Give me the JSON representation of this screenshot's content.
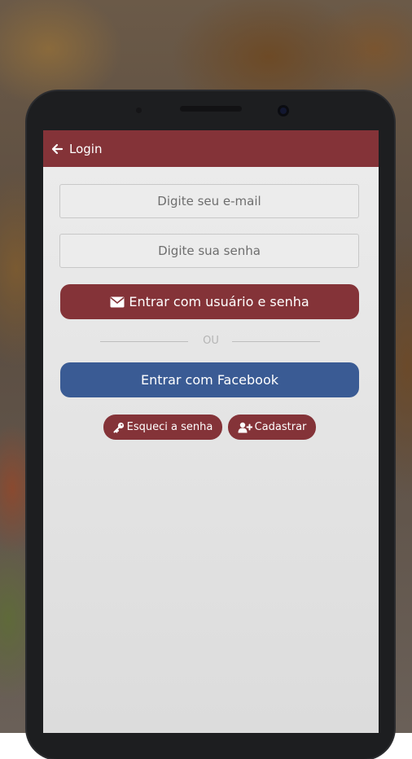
{
  "appbar": {
    "title": "Login"
  },
  "form": {
    "email_placeholder": "Digite seu e-mail",
    "password_placeholder": "Digite sua senha",
    "login_button_label": "Entrar com usuário e senha",
    "divider_text": "OU",
    "facebook_button_label": "Entrar com Facebook",
    "forgot_password_label": "Esqueci a senha",
    "signup_label": "Cadastrar"
  },
  "icons": {
    "back": "arrow-left-icon",
    "login": "envelope-icon",
    "forgot": "key-icon",
    "signup": "user-plus-icon"
  },
  "colors": {
    "primary": "#843338",
    "facebook": "#3a5b94",
    "screen_background": "#e4e4e4"
  }
}
